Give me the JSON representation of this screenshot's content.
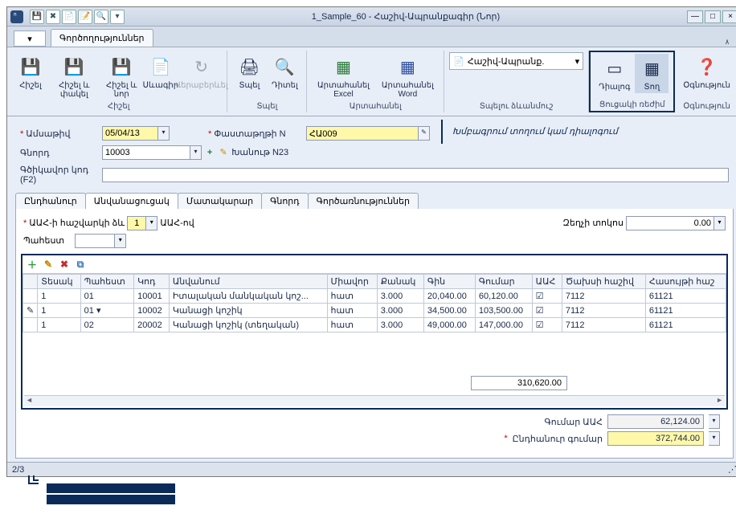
{
  "window": {
    "title": "1_Sample_60 - Հաշիվ-Ապրանքագիր (Նոր)"
  },
  "menubar": {
    "tab": "Գործողություններ"
  },
  "ribbon": {
    "save": {
      "b1": "Հիշել",
      "b2": "Հիշել և փակել",
      "b3": "Հիշել և նոր",
      "b4": "Սևագիր",
      "b5": "Վերաբերևել",
      "label": "Հիշել"
    },
    "print": {
      "b1": "Տպել",
      "b2": "Դիտել",
      "label": "Տպել"
    },
    "export": {
      "b1": "Արտահանել Excel",
      "b2": "Արտահանել Word",
      "label": "Արտահանել"
    },
    "template": {
      "combo": "Հաշիվ-Ապրանք.",
      "label": "Տպելու ձևանմուշ"
    },
    "view": {
      "b1": "Դիալոգ",
      "b2": "Տող",
      "label": "Ցուցակի ռեժիմ"
    },
    "help": {
      "b1": "Օգնություն",
      "label": "Օգնություն"
    }
  },
  "form": {
    "date_lbl": "Ամսաթիվ",
    "date_val": "05/04/13",
    "docno_lbl": "Փաստաթղթի N",
    "docno_val": "ՀԱ009",
    "buyer_lbl": "Գնորդ",
    "buyer_val": "10003",
    "buyer_ext": "Խանութ N23",
    "line_lbl": "Գծիկավոր կոդ (F2)",
    "annotation": "Խմբագրում տողում կամ դիալոգում"
  },
  "subtabs": {
    "t1": "Ընդհանուր",
    "t2": "Անվանացուցակ",
    "t3": "Մատակարար",
    "t4": "Գնորդ",
    "t5": "Գործառնություններ"
  },
  "vat": {
    "lbl1": "ԱԱՀ-ի հաշվարկի ձև",
    "val1": "1",
    "lbl2": "ԱԱՀ-ով",
    "discount_lbl": "Զեղչի տոկոս",
    "discount_val": "0.00",
    "store_lbl": "Պահեստ"
  },
  "grid": {
    "headers": {
      "type": "Տեսակ",
      "store": "Պահեստ",
      "code": "Կոդ",
      "name": "Անվանում",
      "unit": "Միավոր",
      "qty": "Քանակ",
      "price": "Գին",
      "amount": "Գումար",
      "vat": "ԱԱՀ",
      "exp_acc": "Ծախսի հաշիվ",
      "inc_acc": "Հասույթի հաշ"
    },
    "rows": [
      {
        "type": "1",
        "store": "01",
        "code": "10001",
        "name": "Իտալական մանկական կոշ...",
        "unit": "հատ",
        "qty": "3.000",
        "price": "20,040.00",
        "amount": "60,120.00",
        "vat": true,
        "exp": "7112",
        "inc": "61121"
      },
      {
        "type": "1",
        "store": "01",
        "code": "10002",
        "name": "Կանացի կոշիկ",
        "unit": "հատ",
        "qty": "3.000",
        "price": "34,500.00",
        "amount": "103,500.00",
        "vat": true,
        "exp": "7112",
        "inc": "61121"
      },
      {
        "type": "1",
        "store": "02",
        "code": "20002",
        "name": "Կանացի կոշիկ (տեղական)",
        "unit": "հատ",
        "qty": "3.000",
        "price": "49,000.00",
        "amount": "147,000.00",
        "vat": true,
        "exp": "7112",
        "inc": "61121"
      }
    ],
    "total_amount": "310,620.00"
  },
  "totals": {
    "vat_lbl": "Գումար ԱԱՀ",
    "vat_val": "62,124.00",
    "grand_lbl": "Ընդհանուր գումար",
    "grand_val": "372,744.00"
  },
  "status": {
    "pager": "2/3"
  }
}
